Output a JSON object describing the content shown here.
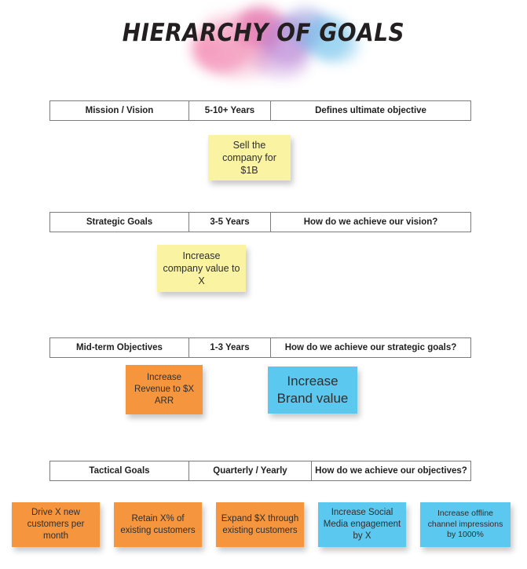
{
  "header": {
    "title": "HIERARCHY OF GOALS",
    "watercolor_colors": [
      "#f27ca8",
      "#e05ca0",
      "#b17ad0",
      "#8f8fd8",
      "#63b9e8",
      "#8fd0ef"
    ]
  },
  "colors": {
    "note_yellow": "#faf4a2",
    "note_orange": "#f5963f",
    "note_blue": "#5bc8ef",
    "table_border": "#7b7b7b",
    "text": "#2e2e2e",
    "background": "#ffffff"
  },
  "rows": [
    {
      "level": "Mission / Vision",
      "timeframe": "5-10+ Years",
      "question": "Defines ultimate objective"
    },
    {
      "level": "Strategic Goals",
      "timeframe": "3-5 Years",
      "question": "How do we achieve our vision?"
    },
    {
      "level": "Mid-term Objectives",
      "timeframe": "1-3 Years",
      "question": "How do we achieve our strategic goals?"
    },
    {
      "level": "Tactical Goals",
      "timeframe": "Quarterly / Yearly",
      "question": "How do we achieve our objectives?"
    }
  ],
  "notes": {
    "mission": [
      {
        "text": "Sell the company for $1B",
        "color": "yellow"
      }
    ],
    "strategic": [
      {
        "text": "Increase company value to X",
        "color": "yellow"
      }
    ],
    "midterm": [
      {
        "text": "Increase Revenue to $X ARR",
        "color": "orange"
      },
      {
        "text": "Increase Brand value",
        "color": "blue"
      }
    ],
    "tactical": [
      {
        "text": "Drive X new customers per month",
        "color": "orange"
      },
      {
        "text": "Retain X% of existing customers",
        "color": "orange"
      },
      {
        "text": "Expand $X through existing customers",
        "color": "orange"
      },
      {
        "text": "Increase Social Media engagement by X",
        "color": "blue"
      },
      {
        "text": "Increase offline channel impressions by 1000%",
        "color": "blue"
      }
    ]
  }
}
